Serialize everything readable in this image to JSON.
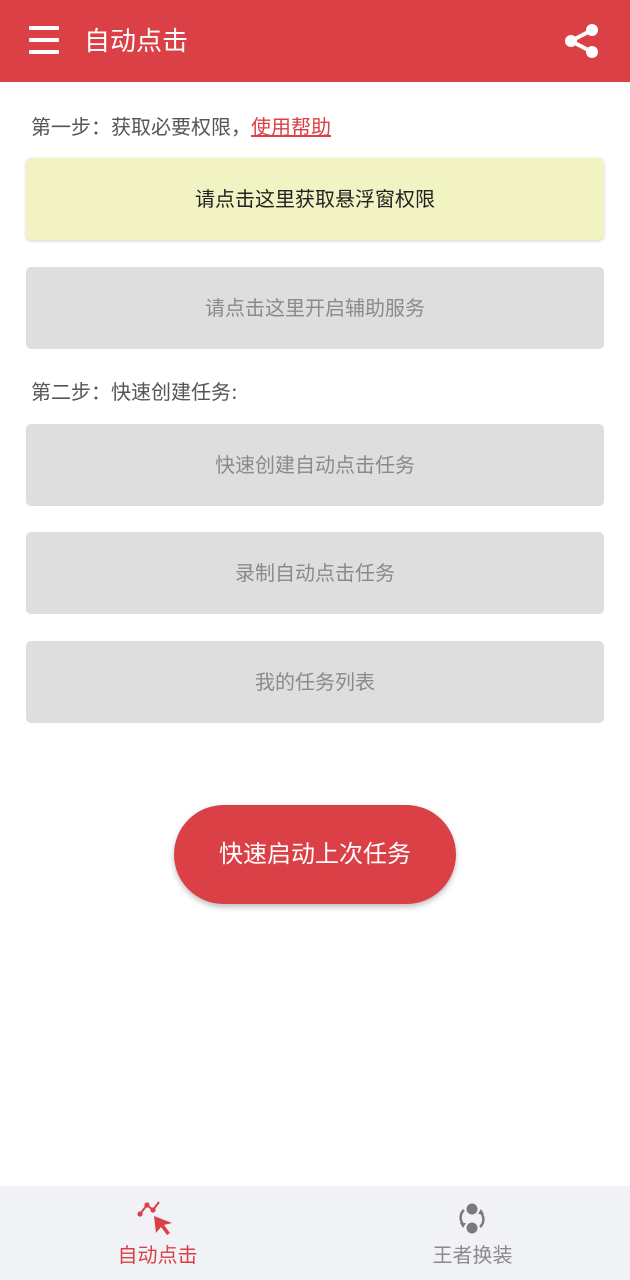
{
  "colors": {
    "primary": "#da4046",
    "overlay_button_bg": "#f1f3c2",
    "disabled_button_bg": "#dedede",
    "bottom_nav_bg": "#f1f2f5"
  },
  "appbar": {
    "title": "自动点击",
    "menu_icon": "hamburger-menu-icon",
    "share_icon": "share-icon"
  },
  "step1": {
    "label": "第一步：获取必要权限，",
    "help_link": "使用帮助"
  },
  "buttons": {
    "overlay_permission": "请点击这里获取悬浮窗权限",
    "accessibility_service": "请点击这里开启辅助服务"
  },
  "step2": {
    "label": "第二步：快速创建任务:"
  },
  "tasks": {
    "quick_create": "快速创建自动点击任务",
    "record": "录制自动点击任务",
    "my_list": "我的任务列表"
  },
  "quick_start": "快速启动上次任务",
  "bottom_nav": [
    {
      "label": "自动点击",
      "icon": "cursor-click-icon",
      "active": true
    },
    {
      "label": "王者换装",
      "icon": "swap-icon",
      "active": false
    }
  ]
}
